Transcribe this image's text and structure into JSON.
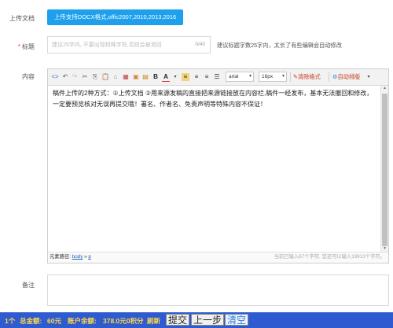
{
  "upload": {
    "label": "上传文档",
    "button_text": "上传支持DOCX格式,offic2007,2010,2013,2016"
  },
  "title": {
    "required_mark": "*",
    "label": "标题",
    "placeholder": "建议25字内, 不要出现特殊字符,否则会被退回",
    "counter": "0/40",
    "hint": "建议标题字数25字内，太长了有些编辑会自动修改"
  },
  "content": {
    "label": "内容",
    "toolbar": {
      "font": "arial",
      "size": "16px",
      "clear_format": "清除格式",
      "auto_layout": "自动排版"
    },
    "text": "稿件上传的2种方式：①上传文档 ②用来源发稿的直接把来源链接放在内容栏,稿件一经发布，基本无法撤回和修改，一定要预览核对无误再提交哦！署名、作者名、免责声明等特殊内容不保证！",
    "status": {
      "path_label": "元素路径:",
      "path_body": "body",
      "path_sep": "»",
      "path_p": "p",
      "count": "当前已输入87个字符, 您还可以输入19913个字符。"
    }
  },
  "remark": {
    "label": "备注"
  },
  "footer": {
    "count": "1个",
    "total_label": "总金额:",
    "total_value": "60元",
    "balance_label": "账户余额:",
    "balance_value": "378.0元0积分",
    "refresh": "刷新",
    "submit": "提交",
    "prev": "上一步",
    "clear": "清空"
  },
  "colors": {
    "upload_button": "#1fa0ec",
    "footer_bg": "#2e5bd0",
    "footer_text": "#ffd84a"
  }
}
